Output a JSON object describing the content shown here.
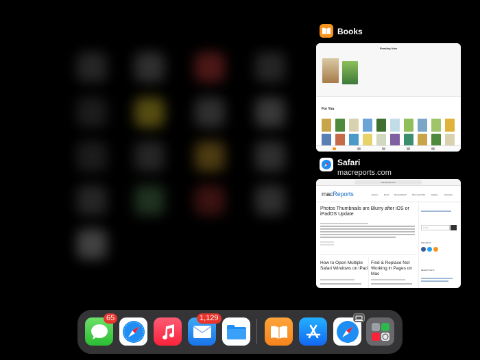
{
  "switcher": {
    "books": {
      "title": "Books",
      "icon": "books-icon",
      "reading_now": "Reading Now",
      "for_you": "For You"
    },
    "safari": {
      "title": "Safari",
      "subtitle": "macreports.com",
      "icon": "safari-icon",
      "url": "macreports.com",
      "logo_prefix": "mac",
      "logo_suffix": "Reports",
      "nav": [
        "How to",
        "News",
        "Not working?",
        "Tips and tricks",
        "Guides",
        "Glossary"
      ],
      "article1_title": "Photos Thumbnails are Blurry after iOS or iPadOS Update",
      "article2_title": "How to Open Multiple Safari Windows on iPad",
      "article3_title": "Find & Replace Not Working in Pages on Mac",
      "sidebar_search": "Search ...",
      "follow_us": "FOLLOW US",
      "recent_posts": "RECENT POSTS"
    }
  },
  "dock": {
    "messages_badge": "65",
    "mail_badge": "1,129",
    "apps": [
      "messages",
      "safari",
      "music",
      "mail",
      "files",
      "books",
      "app-store",
      "safari-recent",
      "app-library"
    ]
  },
  "colors": {
    "accent_blue": "#1a6fc4",
    "badge_red": "#e8342d",
    "books_orange": "#f7941d"
  }
}
